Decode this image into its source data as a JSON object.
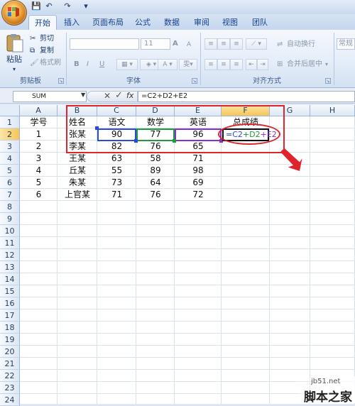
{
  "quick_access": {
    "save": "💾",
    "undo": "↶",
    "redo": "↷",
    "more": "▾"
  },
  "tabs": [
    "开始",
    "插入",
    "页面布局",
    "公式",
    "数据",
    "审阅",
    "视图",
    "团队"
  ],
  "ribbon": {
    "clipboard": {
      "paste": "粘贴",
      "cut": "剪切",
      "copy": "复制",
      "format_painter": "格式刷",
      "label": "剪贴板"
    },
    "font": {
      "font_name": "",
      "font_size": "11",
      "grow": "A",
      "shrink": "A",
      "bold": "B",
      "italic": "I",
      "underline": "U",
      "label": "字体",
      "wen": "雯"
    },
    "alignment": {
      "wrap_text": "自动换行",
      "merge_center": "合并后居中",
      "label": "对齐方式"
    },
    "number": {
      "format": "常规"
    }
  },
  "formula_bar": {
    "name_box": "SUM",
    "cancel": "✕",
    "enter": "✓",
    "fx": "fx",
    "formula": "=C2+D2+E2"
  },
  "columns": [
    "A",
    "B",
    "C",
    "D",
    "E",
    "F",
    "G",
    "H"
  ],
  "rows": [
    "1",
    "2",
    "3",
    "4",
    "5",
    "6",
    "7",
    "8",
    "9",
    "10",
    "11",
    "12",
    "13",
    "14",
    "15",
    "16",
    "17",
    "18",
    "19",
    "20",
    "21",
    "22",
    "23",
    "24"
  ],
  "table": {
    "headers": [
      "学号",
      "姓名",
      "语文",
      "数学",
      "英语",
      "总成绩"
    ],
    "data": [
      [
        "1",
        "张某",
        "90",
        "77",
        "96",
        ""
      ],
      [
        "2",
        "李某",
        "82",
        "76",
        "65",
        ""
      ],
      [
        "3",
        "王某",
        "63",
        "58",
        "71",
        ""
      ],
      [
        "4",
        "丘某",
        "55",
        "89",
        "98",
        ""
      ],
      [
        "5",
        "朱某",
        "73",
        "64",
        "69",
        ""
      ],
      [
        "6",
        "上官某",
        "71",
        "76",
        "72",
        ""
      ]
    ]
  },
  "edit_cell": {
    "p1": "=C2",
    "p2": "+D2",
    "p3": "+E2"
  },
  "watermark": {
    "site": "jb51.net",
    "name": "脚本之家"
  },
  "colors": {
    "ref_c": "#2a4bd7",
    "ref_d": "#1f9a3c",
    "ref_e": "#8a2fc8",
    "highlight": "#e0242c"
  }
}
